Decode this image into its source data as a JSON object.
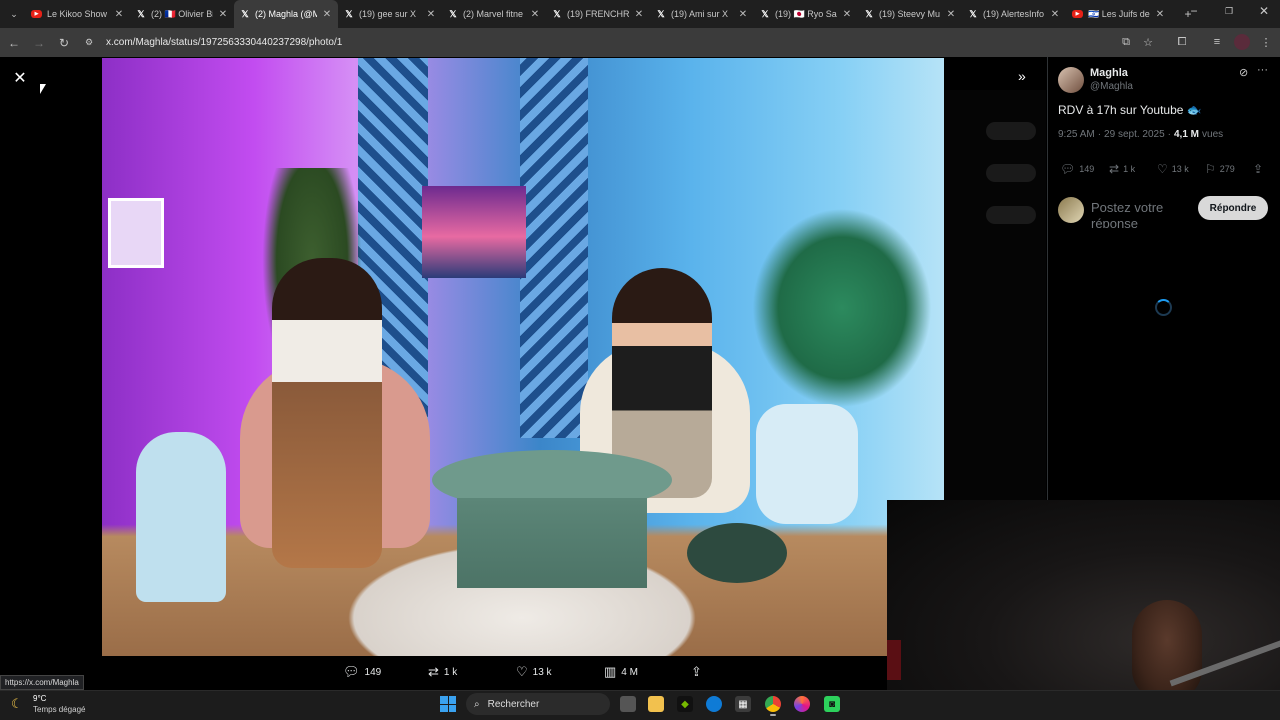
{
  "tabs": [
    {
      "title": "Le Kikoo Show",
      "favicon": "youtube-icon",
      "active": false
    },
    {
      "title": "(2) 🇫🇷 Olivier Bi",
      "favicon": "x-icon",
      "active": false
    },
    {
      "title": "(2) Maghla (@Ma",
      "favicon": "x-icon",
      "active": true
    },
    {
      "title": "(19) gee sur X",
      "favicon": "x-icon",
      "active": false
    },
    {
      "title": "(2) Marvel fitne",
      "favicon": "x-icon",
      "active": false
    },
    {
      "title": "(19) FRENCHRA",
      "favicon": "x-icon",
      "active": false
    },
    {
      "title": "(19) Ami sur X",
      "favicon": "x-icon",
      "active": false
    },
    {
      "title": "(19) 🇯🇵 Ryo Sai",
      "favicon": "x-icon",
      "active": false
    },
    {
      "title": "(19) Steevy Mu",
      "favicon": "x-icon",
      "active": false
    },
    {
      "title": "(19) AlertesInfo",
      "favicon": "x-icon",
      "active": false
    },
    {
      "title": "🇮🇱 Les Juifs de",
      "favicon": "youtube-icon",
      "active": false
    }
  ],
  "address": {
    "url": "x.com/Maghla/status/1972563330440237298/photo/1"
  },
  "post": {
    "display_name": "Maghla",
    "handle": "@Maghla",
    "text": "RDV à 17h sur Youtube 🐟",
    "time": "9:25 AM",
    "dot": "·",
    "date": "29 sept. 2025",
    "views_count": "4,1 M",
    "views_label": "vues",
    "replies": "149",
    "reposts": "1 k",
    "likes": "13 k",
    "bookmarks": "279",
    "reply_placeholder": "Postez votre réponse",
    "reply_button": "Répondre"
  },
  "media_bar": {
    "replies": "149",
    "reposts": "1 k",
    "likes": "13 k",
    "views": "4 M"
  },
  "status_url": "https://x.com/Maghla",
  "taskbar": {
    "temperature": "9°C",
    "weather": "Temps dégagé",
    "search_label": "Rechercher"
  },
  "colors": {
    "accent": "#1d9bf0",
    "background": "#000000",
    "muted": "#71767b"
  }
}
